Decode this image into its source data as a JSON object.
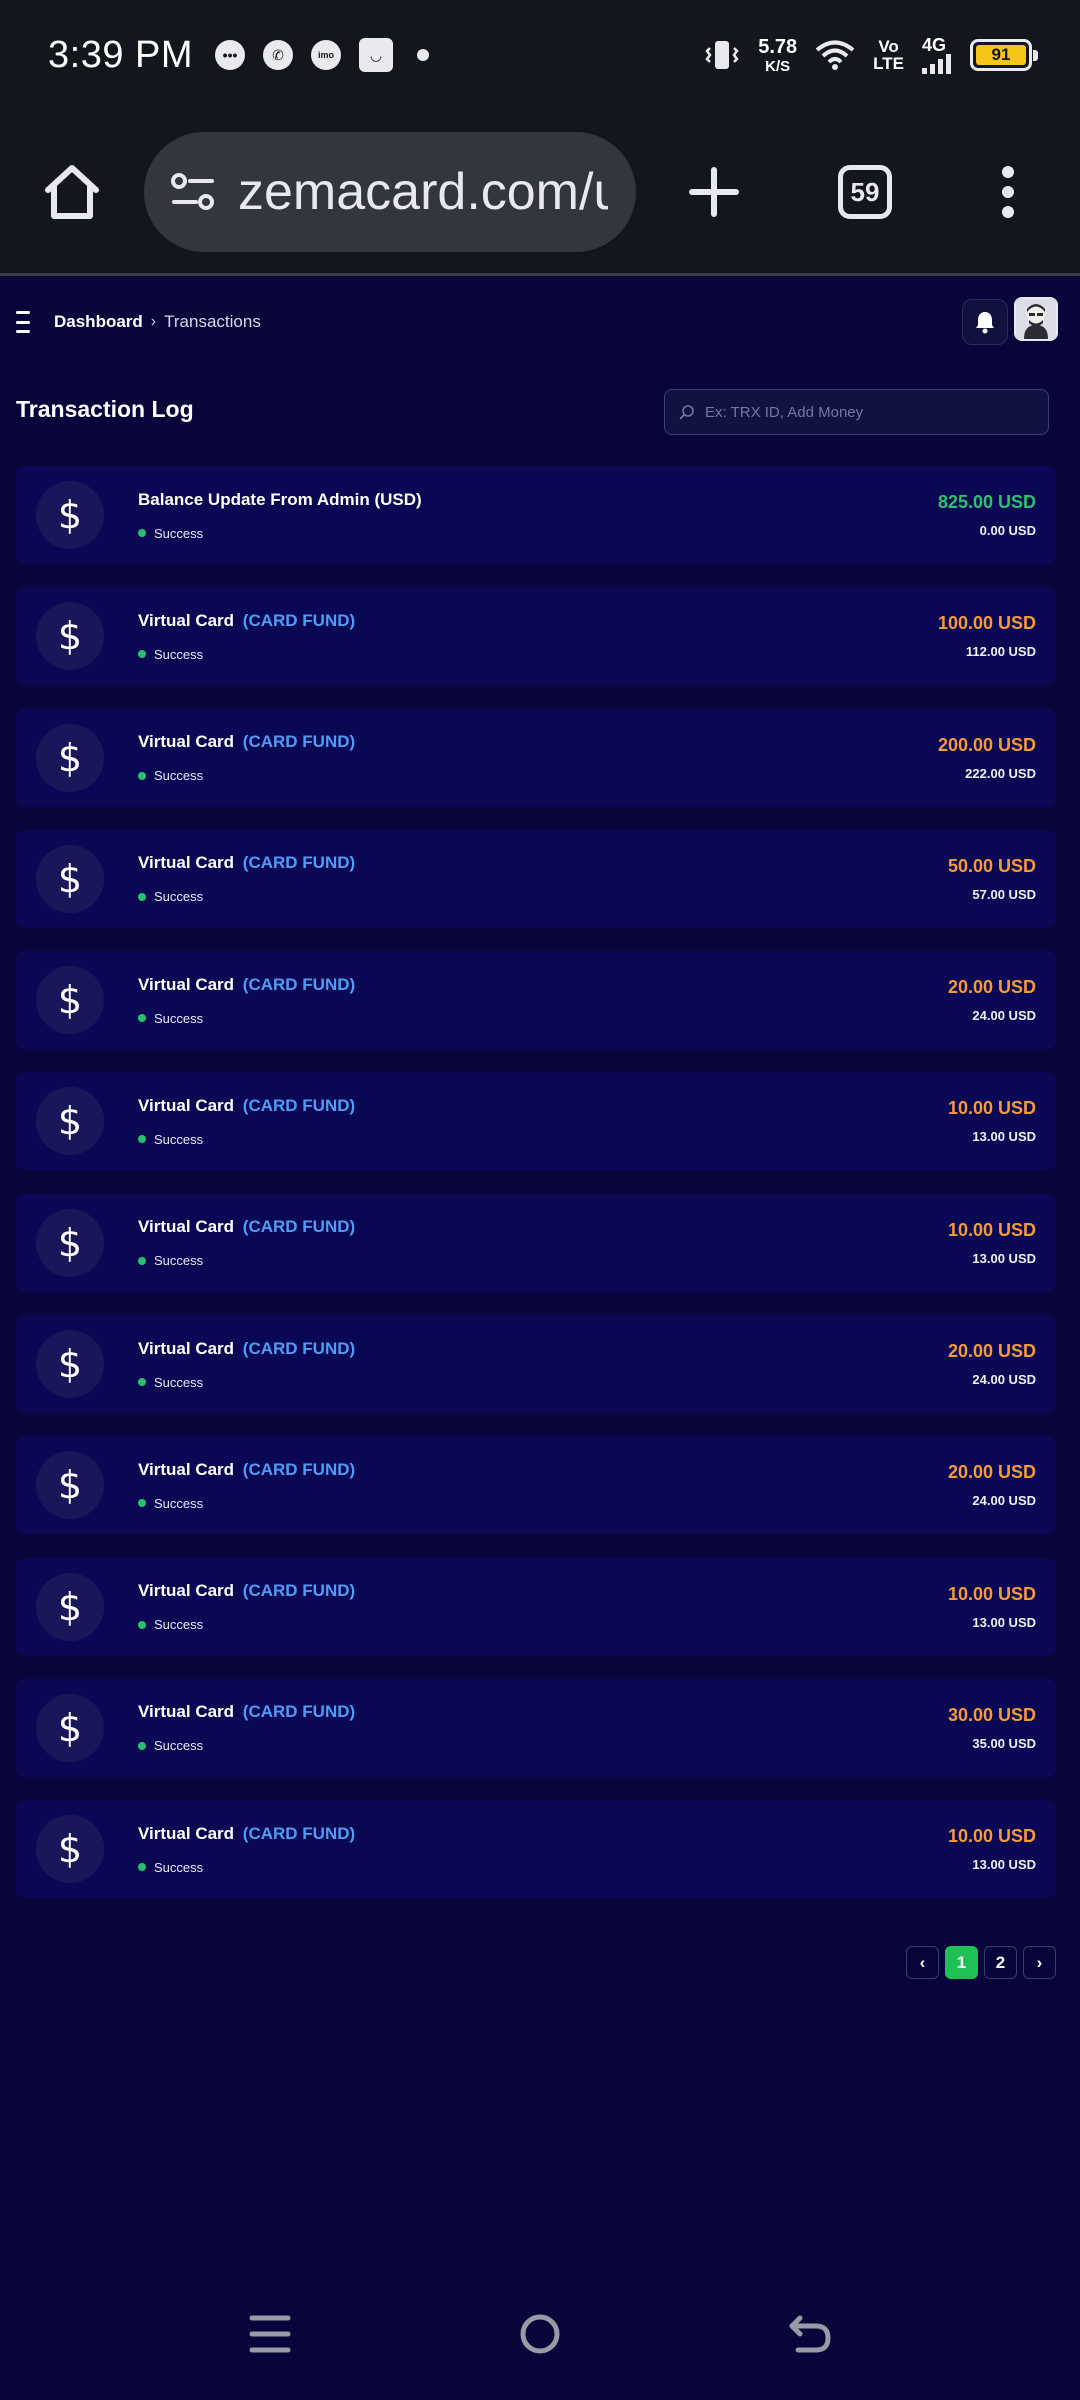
{
  "status_bar": {
    "time": "3:39 PM",
    "net_speed_value": "5.78",
    "net_speed_unit": "K/S",
    "volte_top": "Vo",
    "volte_bottom": "LTE",
    "network": "4G",
    "battery": "91",
    "notification_icons": [
      "chat-bubble-icon",
      "whatsapp-icon",
      "imo-icon",
      "shopping-bag-icon"
    ]
  },
  "browser": {
    "url": "zemacard.com/us",
    "tab_count": "59"
  },
  "header": {
    "breadcrumb_home": "Dashboard",
    "breadcrumb_current": "Transactions"
  },
  "log": {
    "title": "Transaction Log",
    "search_placeholder": "Ex: TRX ID, Add Money"
  },
  "transactions": [
    {
      "icon": "$",
      "title": "Balance Update From Admin (USD)",
      "tag": "",
      "status": "Success",
      "amount": "825.00 USD",
      "charge": "0.00 USD",
      "amount_color": "#28c46b"
    },
    {
      "icon": "$",
      "title": "Virtual Card",
      "tag": "(CARD FUND)",
      "status": "Success",
      "amount": "100.00 USD",
      "charge": "112.00 USD",
      "amount_color": "#f59a36"
    },
    {
      "icon": "$",
      "title": "Virtual Card",
      "tag": "(CARD FUND)",
      "status": "Success",
      "amount": "200.00 USD",
      "charge": "222.00 USD",
      "amount_color": "#f59a36"
    },
    {
      "icon": "$",
      "title": "Virtual Card",
      "tag": "(CARD FUND)",
      "status": "Success",
      "amount": "50.00 USD",
      "charge": "57.00 USD",
      "amount_color": "#f59a36"
    },
    {
      "icon": "$",
      "title": "Virtual Card",
      "tag": "(CARD FUND)",
      "status": "Success",
      "amount": "20.00 USD",
      "charge": "24.00 USD",
      "amount_color": "#f59a36"
    },
    {
      "icon": "$",
      "title": "Virtual Card",
      "tag": "(CARD FUND)",
      "status": "Success",
      "amount": "10.00 USD",
      "charge": "13.00 USD",
      "amount_color": "#f59a36"
    },
    {
      "icon": "$",
      "title": "Virtual Card",
      "tag": "(CARD FUND)",
      "status": "Success",
      "amount": "10.00 USD",
      "charge": "13.00 USD",
      "amount_color": "#f59a36"
    },
    {
      "icon": "$",
      "title": "Virtual Card",
      "tag": "(CARD FUND)",
      "status": "Success",
      "amount": "20.00 USD",
      "charge": "24.00 USD",
      "amount_color": "#f59a36"
    },
    {
      "icon": "$",
      "title": "Virtual Card",
      "tag": "(CARD FUND)",
      "status": "Success",
      "amount": "20.00 USD",
      "charge": "24.00 USD",
      "amount_color": "#f59a36"
    },
    {
      "icon": "$",
      "title": "Virtual Card",
      "tag": "(CARD FUND)",
      "status": "Success",
      "amount": "10.00 USD",
      "charge": "13.00 USD",
      "amount_color": "#f59a36"
    },
    {
      "icon": "$",
      "title": "Virtual Card",
      "tag": "(CARD FUND)",
      "status": "Success",
      "amount": "30.00 USD",
      "charge": "35.00 USD",
      "amount_color": "#f59a36"
    },
    {
      "icon": "$",
      "title": "Virtual Card",
      "tag": "(CARD FUND)",
      "status": "Success",
      "amount": "10.00 USD",
      "charge": "13.00 USD",
      "amount_color": "#f59a36"
    }
  ],
  "pagination": {
    "prev": "‹",
    "pages": [
      "1",
      "2"
    ],
    "active_page": "1",
    "next": "›"
  },
  "colors": {
    "page_bg": "#07053a",
    "card_bg": "#0a0855",
    "success_green": "#25c46a",
    "amount_orange": "#f59a36",
    "tag_blue": "#4e9cf5",
    "active_page": "#1fc157"
  }
}
